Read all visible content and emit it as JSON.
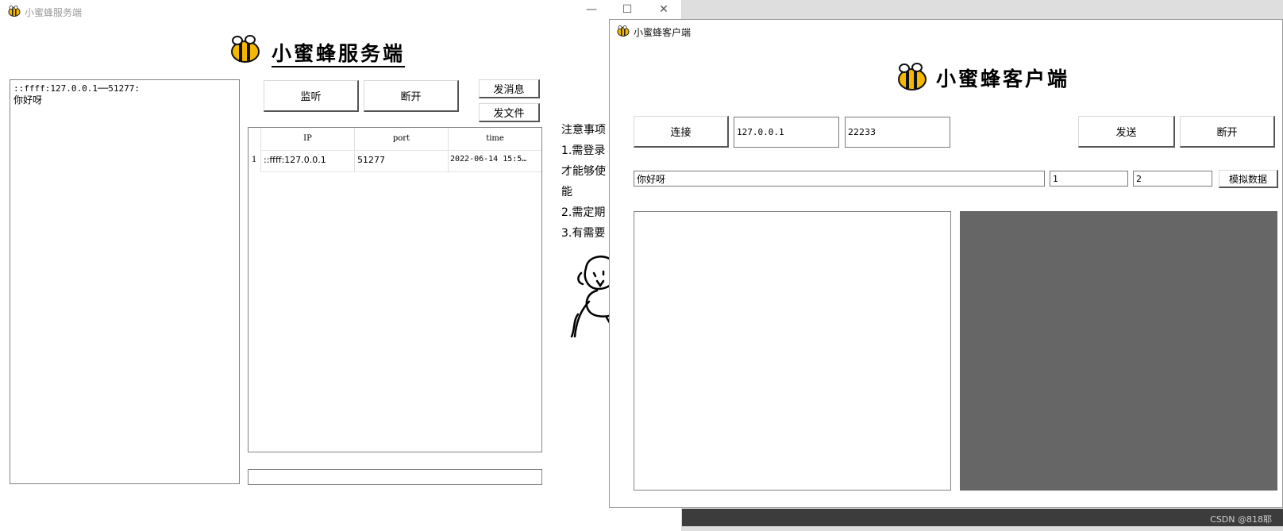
{
  "server": {
    "title": "小蜜蜂服务端",
    "heading": "小蜜蜂服务端",
    "message_log": [
      "::ffff:127.0.0.1──51277:",
      "你好呀"
    ],
    "buttons": {
      "listen": "监听",
      "disconnect": "断开",
      "send_message": "发消息",
      "send_file": "发文件"
    },
    "table": {
      "headers": [
        "IP",
        "port",
        "time"
      ],
      "rows": [
        {
          "index": "1",
          "ip": "::ffff:127.0.0.1",
          "port": "51277",
          "time": "2022-06-14 15:5…"
        }
      ]
    },
    "input_value": "",
    "notes": [
      "注意事项",
      "1.需登录",
      "才能够使",
      "能",
      "2.需定期",
      "3.有需要"
    ]
  },
  "client": {
    "title": "小蜜蜂客户端",
    "heading": "小蜜蜂客户端",
    "buttons": {
      "connect": "连接",
      "send": "发送",
      "disconnect": "断开",
      "simulate": "模拟数据"
    },
    "ip_value": "127.0.0.1",
    "port_value": "22233",
    "message_value": "你好呀",
    "field1_value": "1",
    "field2_value": "2"
  },
  "watermark": "CSDN @818耶",
  "colors": {
    "bee_yellow": "#f5b800",
    "display_gray": "#666666",
    "taskbar": "#3c3c3c"
  }
}
